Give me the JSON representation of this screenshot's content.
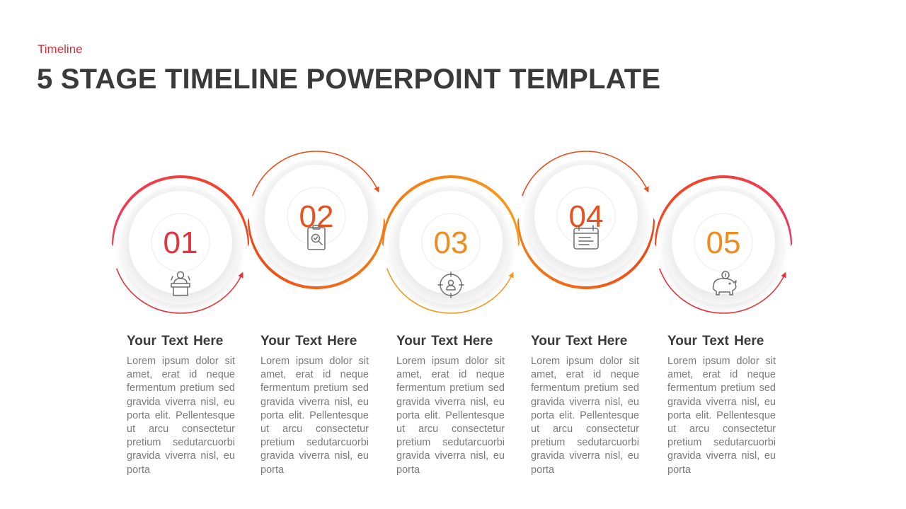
{
  "header": {
    "kicker": "Timeline",
    "title": "5 STAGE TIMELINE POWERPOINT TEMPLATE"
  },
  "colors": {
    "kicker": "#d2323c",
    "title": "#3a3a3a",
    "body_text": "#7a7a7a"
  },
  "stages": [
    {
      "number": "01",
      "icon": "speaker-podium-icon",
      "number_color": "#e0353f",
      "ribbon": [
        "#f0385a",
        "#f2481e"
      ],
      "arrow_color": "#e0353f",
      "heading": "Your  Text Here",
      "body": "Lorem ipsum dolor sit amet, erat id neque fermentum pretium sed gravida viverra nisl, eu porta elit. Pellentesque ut arcu consectetur pretium sedutarcuorbi gravida viverra nisl, eu porta"
    },
    {
      "number": "02",
      "icon": "clipboard-search-icon",
      "number_color": "#e8501e",
      "ribbon": [
        "#f04412",
        "#f57a12"
      ],
      "arrow_color": "#e8501e",
      "heading": "Your  Text Here",
      "body": "Lorem ipsum dolor sit amet, erat id neque fermentum pretium sed gravida viverra nisl, eu porta elit. Pellentesque ut arcu consectetur pretium sedutarcuorbi gravida viverra nisl, eu porta"
    },
    {
      "number": "03",
      "icon": "target-user-icon",
      "number_color": "#f08c1e",
      "ribbon": [
        "#f57812",
        "#f89a1a"
      ],
      "arrow_color": "#f39a22",
      "heading": "Your  Text Here",
      "body": "Lorem ipsum dolor sit amet, erat id neque fermentum pretium sed gravida viverra nisl, eu porta elit. Pellentesque ut arcu consectetur pretium sedutarcuorbi gravida viverra nisl, eu porta"
    },
    {
      "number": "04",
      "icon": "calendar-icon",
      "number_color": "#e8501e",
      "ribbon": [
        "#f57a12",
        "#f04412"
      ],
      "arrow_color": "#e8501e",
      "heading": "Your  Text Here",
      "body": "Lorem ipsum dolor sit amet, erat id neque fermentum pretium sed gravida viverra nisl, eu porta elit. Pellentesque ut arcu consectetur pretium sedutarcuorbi gravida viverra nisl, eu porta"
    },
    {
      "number": "05",
      "icon": "piggy-bank-icon",
      "number_color": "#f08c1e",
      "ribbon": [
        "#f2481e",
        "#f0385a"
      ],
      "arrow_color": "#e0353f",
      "heading": "Your  Text Here",
      "body": "Lorem ipsum dolor sit amet, erat id neque fermentum pretium sed gravida viverra nisl, eu porta elit. Pellentesque ut arcu consectetur pretium sedutarcuorbi gravida viverra nisl, eu porta"
    }
  ]
}
